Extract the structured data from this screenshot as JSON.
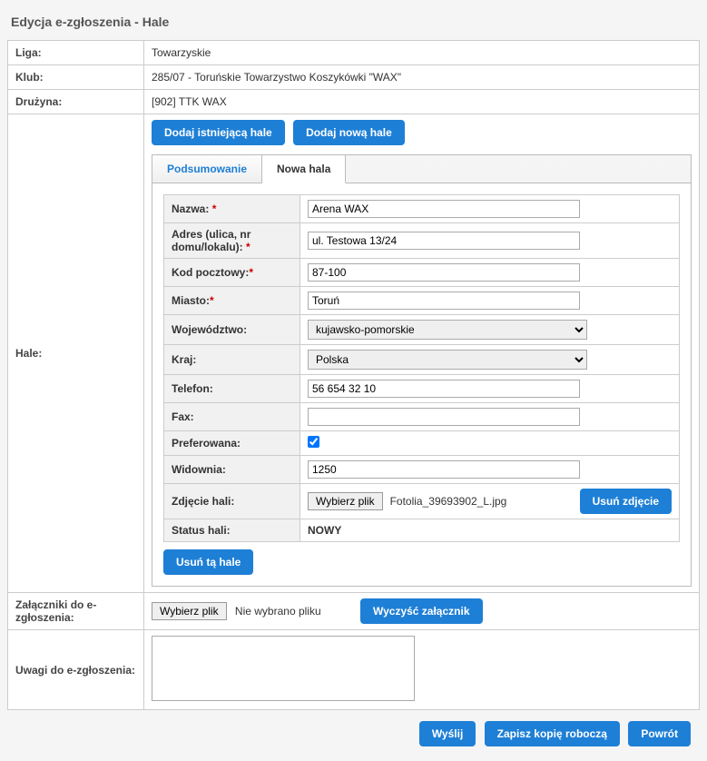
{
  "page_title": "Edycja e-zgłoszenia - Hale",
  "header": {
    "liga_label": "Liga:",
    "liga_value": "Towarzyskie",
    "klub_label": "Klub:",
    "klub_value": "285/07 - Toruńskie Towarzystwo Koszykówki \"WAX\"",
    "druzyna_label": "Drużyna:",
    "druzyna_value": "[902] TTK WAX"
  },
  "hale": {
    "label": "Hale:",
    "btn_add_existing": "Dodaj istniejącą hale",
    "btn_add_new": "Dodaj nową hale",
    "tabs": {
      "summary": "Podsumowanie",
      "new_hall": "Nowa hala"
    },
    "form": {
      "nazwa_label": "Nazwa:",
      "nazwa_value": "Arena WAX",
      "adres_label": "Adres (ulica, nr domu/lokalu):",
      "adres_value": "ul. Testowa 13/24",
      "kod_label": "Kod pocztowy:",
      "kod_value": "87-100",
      "miasto_label": "Miasto:",
      "miasto_value": "Toruń",
      "woj_label": "Województwo:",
      "woj_value": "kujawsko-pomorskie",
      "kraj_label": "Kraj:",
      "kraj_value": "Polska",
      "telefon_label": "Telefon:",
      "telefon_value": "56 654 32 10",
      "fax_label": "Fax:",
      "fax_value": "",
      "pref_label": "Preferowana:",
      "widownia_label": "Widownia:",
      "widownia_value": "1250",
      "zdjecie_label": "Zdjęcie hali:",
      "file_btn": "Wybierz plik",
      "file_name": "Fotolia_39693902_L.jpg",
      "btn_delete_photo": "Usuń zdjęcie",
      "status_label": "Status hali:",
      "status_value": "NOWY",
      "btn_delete_hall": "Usuń tą hale"
    }
  },
  "attachments": {
    "label": "Załączniki do e-zgłoszenia:",
    "file_btn": "Wybierz plik",
    "no_file": "Nie wybrano pliku",
    "btn_clear": "Wyczyść załącznik"
  },
  "remarks": {
    "label": "Uwagi do e-zgłoszenia:",
    "value": ""
  },
  "footer": {
    "send": "Wyślij",
    "save_draft": "Zapisz kopię roboczą",
    "back": "Powrót"
  }
}
